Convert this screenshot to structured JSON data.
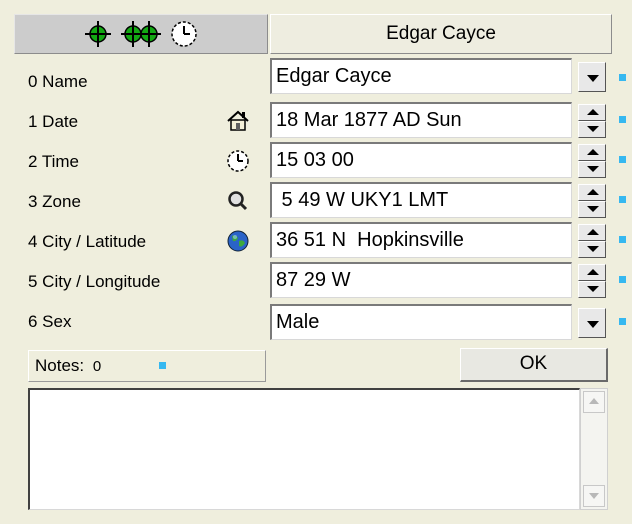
{
  "header": {
    "chart_name": "Edgar Cayce",
    "toolbar_icons": [
      "crosshair-icon",
      "double-crosshair-icon",
      "clock-icon"
    ]
  },
  "rows": [
    {
      "label": "0 Name",
      "value": "Edgar Cayce",
      "control": "dropdown",
      "icon": null
    },
    {
      "label": "1 Date",
      "value": "18 Mar 1877 AD Sun",
      "control": "spinner",
      "icon": "house-icon"
    },
    {
      "label": "2 Time",
      "value": "15 03 00",
      "control": "spinner",
      "icon": "clock-icon"
    },
    {
      "label": "3 Zone",
      "value": " 5 49 W UKY1 LMT",
      "control": "spinner",
      "icon": "magnifier-icon"
    },
    {
      "label": "4 City / Latitude",
      "value": "36 51 N  Hopkinsville",
      "control": "spinner",
      "icon": "globe-icon"
    },
    {
      "label": "5 City / Longitude",
      "value": "87 29 W",
      "control": "spinner",
      "icon": null
    },
    {
      "label": "6 Sex",
      "value": "Male",
      "control": "dropdown",
      "icon": null
    }
  ],
  "notes": {
    "label": "Notes:",
    "count": "0",
    "text": ""
  },
  "ok_label": "OK",
  "colors": {
    "panel_bg": "#efeedd",
    "indicator": "#36b8f0",
    "crosshair": "#13a813"
  }
}
